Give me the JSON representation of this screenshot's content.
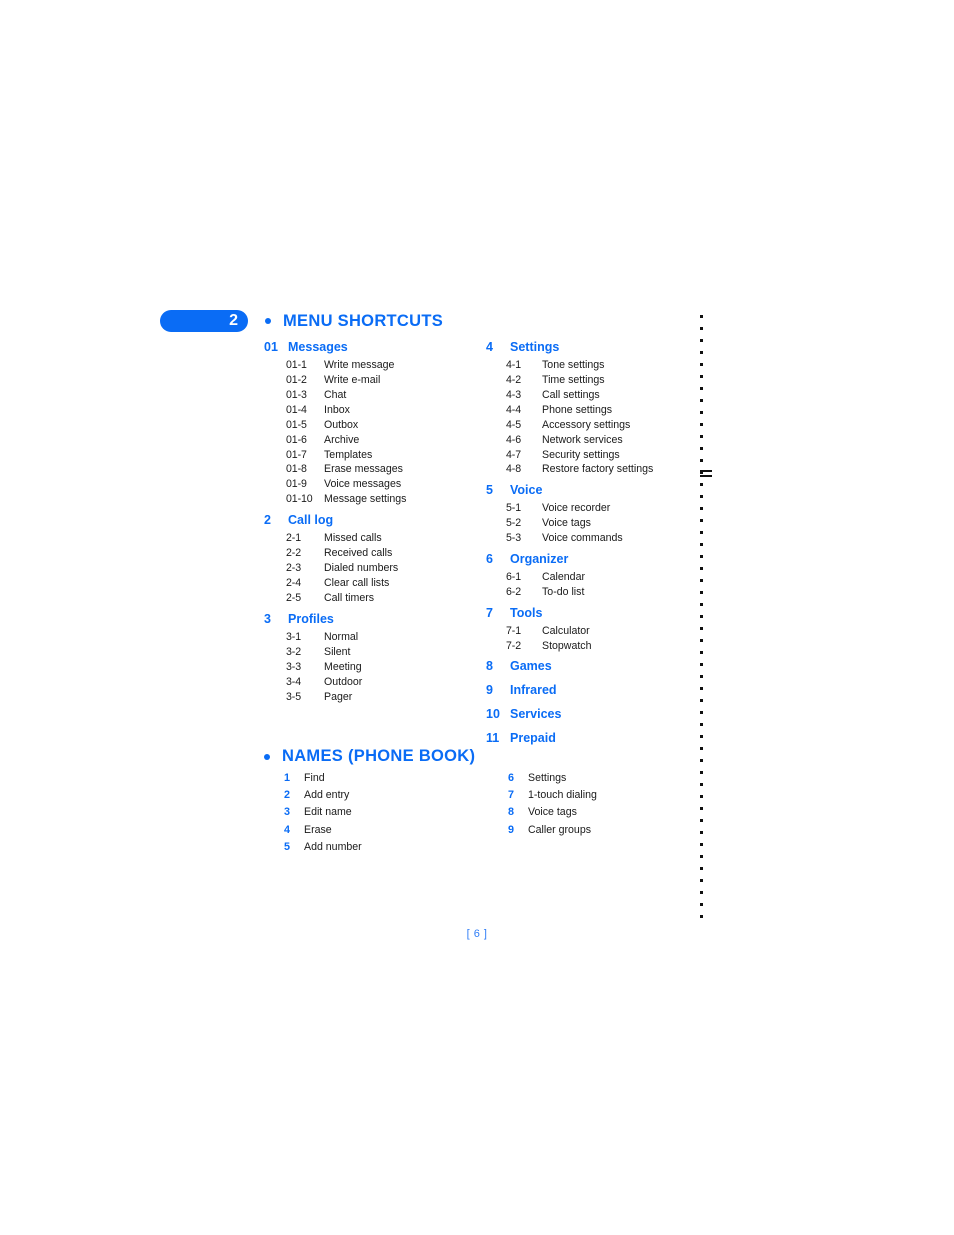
{
  "document": {
    "page_number_label": "[ 6 ]"
  },
  "chapter": {
    "number": "2",
    "title": "MENU SHORTCUTS"
  },
  "menu_shortcuts": {
    "left_column": [
      {
        "number": "01",
        "label": "Messages",
        "items": [
          {
            "number": "01-1",
            "label": "Write message"
          },
          {
            "number": "01-2",
            "label": "Write e-mail"
          },
          {
            "number": "01-3",
            "label": "Chat"
          },
          {
            "number": "01-4",
            "label": "Inbox"
          },
          {
            "number": "01-5",
            "label": "Outbox"
          },
          {
            "number": "01-6",
            "label": "Archive"
          },
          {
            "number": "01-7",
            "label": "Templates"
          },
          {
            "number": "01-8",
            "label": "Erase messages"
          },
          {
            "number": "01-9",
            "label": "Voice messages"
          },
          {
            "number": "01-10",
            "label": "Message settings"
          }
        ]
      },
      {
        "number": "2",
        "label": "Call log",
        "items": [
          {
            "number": "2-1",
            "label": "Missed calls"
          },
          {
            "number": "2-2",
            "label": "Received calls"
          },
          {
            "number": "2-3",
            "label": "Dialed numbers"
          },
          {
            "number": "2-4",
            "label": "Clear call lists"
          },
          {
            "number": "2-5",
            "label": "Call timers"
          }
        ]
      },
      {
        "number": "3",
        "label": "Profiles",
        "items": [
          {
            "number": "3-1",
            "label": "Normal"
          },
          {
            "number": "3-2",
            "label": "Silent"
          },
          {
            "number": "3-3",
            "label": "Meeting"
          },
          {
            "number": "3-4",
            "label": "Outdoor"
          },
          {
            "number": "3-5",
            "label": "Pager"
          }
        ]
      }
    ],
    "right_column": [
      {
        "number": "4",
        "label": "Settings",
        "items": [
          {
            "number": "4-1",
            "label": "Tone settings"
          },
          {
            "number": "4-2",
            "label": "Time settings"
          },
          {
            "number": "4-3",
            "label": "Call settings"
          },
          {
            "number": "4-4",
            "label": "Phone settings"
          },
          {
            "number": "4-5",
            "label": "Accessory settings"
          },
          {
            "number": "4-6",
            "label": "Network services"
          },
          {
            "number": "4-7",
            "label": "Security settings"
          },
          {
            "number": "4-8",
            "label": "Restore factory settings"
          }
        ]
      },
      {
        "number": "5",
        "label": "Voice",
        "items": [
          {
            "number": "5-1",
            "label": "Voice recorder"
          },
          {
            "number": "5-2",
            "label": "Voice tags"
          },
          {
            "number": "5-3",
            "label": "Voice commands"
          }
        ]
      },
      {
        "number": "6",
        "label": "Organizer",
        "items": [
          {
            "number": "6-1",
            "label": "Calendar"
          },
          {
            "number": "6-2",
            "label": "To-do list"
          }
        ]
      },
      {
        "number": "7",
        "label": "Tools",
        "items": [
          {
            "number": "7-1",
            "label": "Calculator"
          },
          {
            "number": "7-2",
            "label": "Stopwatch"
          }
        ]
      },
      {
        "number": "8",
        "label": "Games",
        "items": []
      },
      {
        "number": "9",
        "label": "Infrared",
        "items": []
      },
      {
        "number": "10",
        "label": "Services",
        "items": []
      },
      {
        "number": "11",
        "label": "Prepaid",
        "items": []
      }
    ]
  },
  "names_section": {
    "title": "NAMES (PHONE BOOK)",
    "left_column": [
      {
        "number": "1",
        "label": "Find"
      },
      {
        "number": "2",
        "label": "Add entry"
      },
      {
        "number": "3",
        "label": "Edit name"
      },
      {
        "number": "4",
        "label": "Erase"
      },
      {
        "number": "5",
        "label": "Add number"
      }
    ],
    "right_column": [
      {
        "number": "6",
        "label": "Settings"
      },
      {
        "number": "7",
        "label": "1-touch dialing"
      },
      {
        "number": "8",
        "label": "Voice tags"
      },
      {
        "number": "9",
        "label": "Caller groups"
      }
    ]
  },
  "theme": {
    "accent_blue": "#0A6CF5",
    "body_text": "#1a1a1a",
    "page_background": "#ffffff",
    "page_number_color": "#2F7DF6"
  }
}
